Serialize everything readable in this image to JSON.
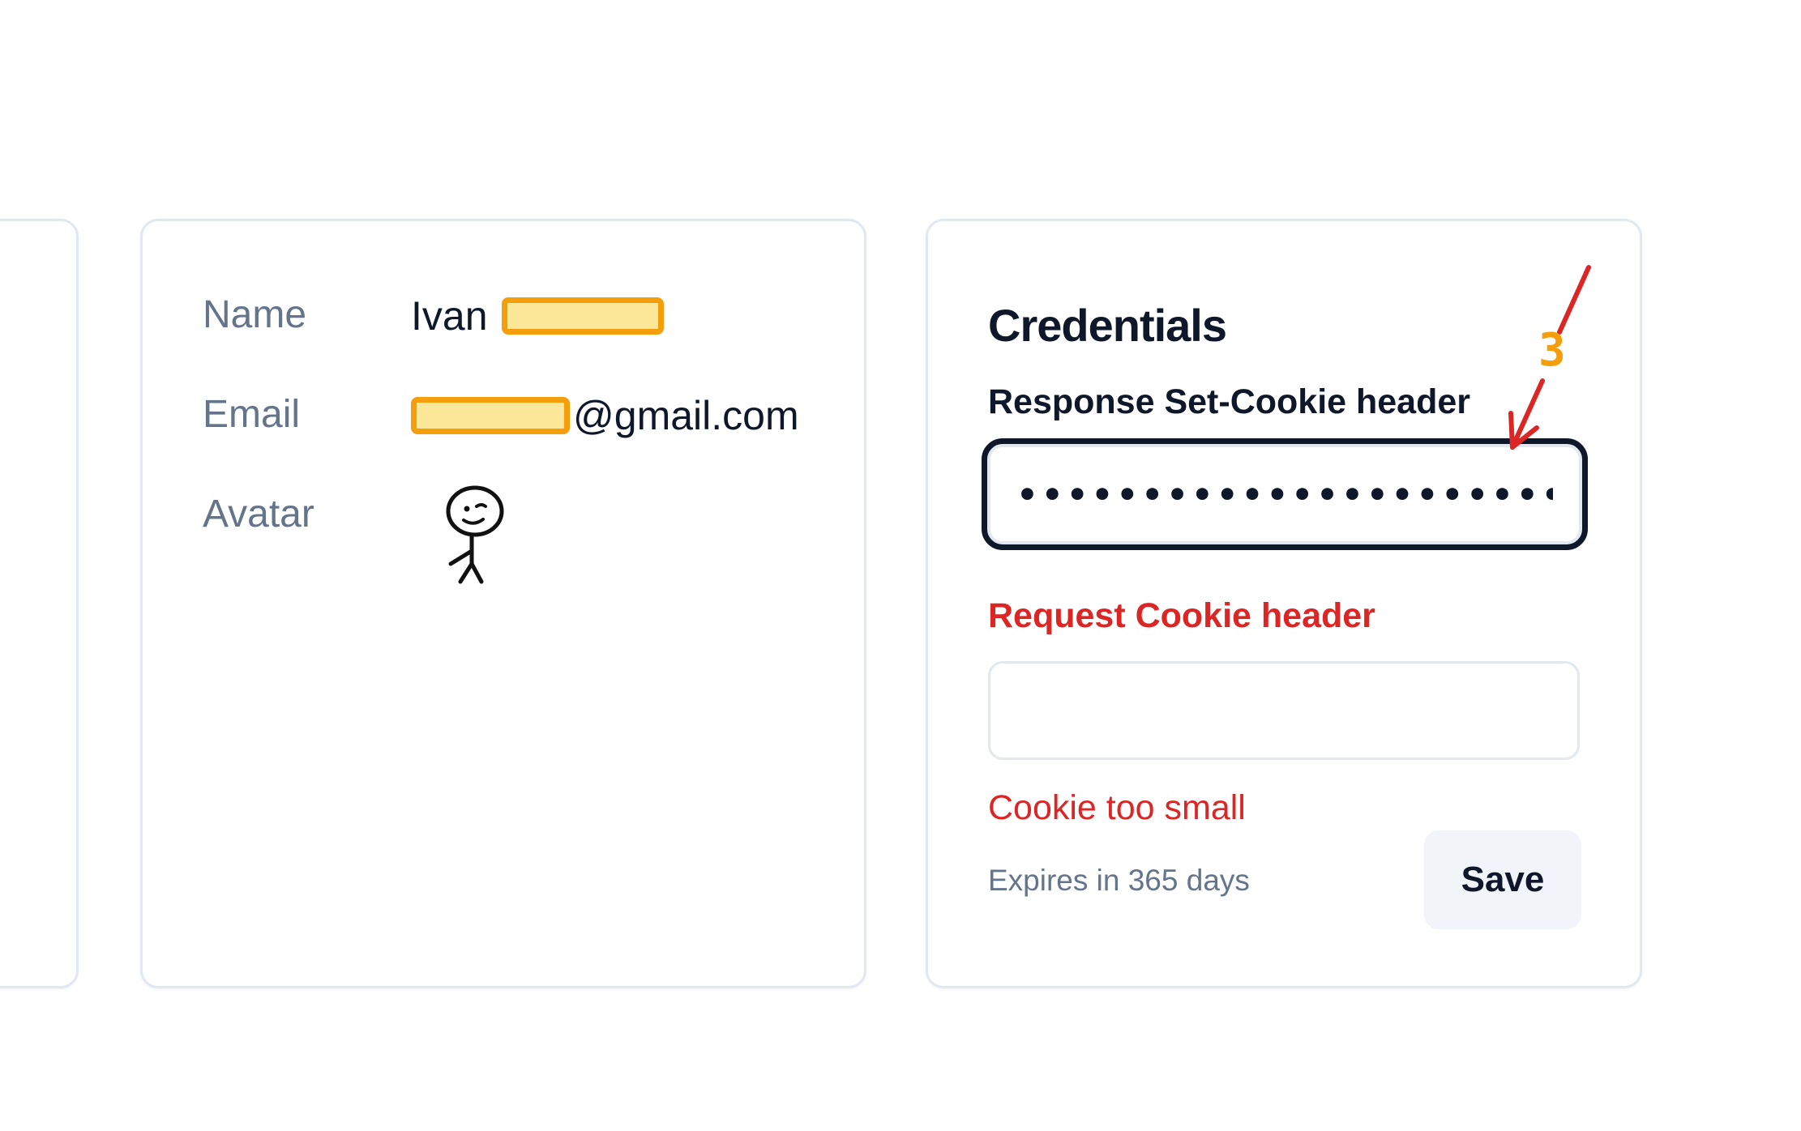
{
  "profile": {
    "name_label": "Name",
    "name_value": "Ivan",
    "email_label": "Email",
    "email_suffix": "@gmail.com",
    "avatar_label": "Avatar"
  },
  "credentials": {
    "title": "Credentials",
    "set_cookie_label": "Response Set-Cookie header",
    "set_cookie_value": "••••••••••••••••••••••••••••••",
    "cookie_label": "Request Cookie header",
    "cookie_value": "",
    "error_message": "Cookie too small",
    "expires_text": "Expires in 365 days",
    "save_label": "Save"
  },
  "annotation": {
    "number": "3"
  },
  "colors": {
    "error": "#dc2626",
    "text": "#0f172a",
    "muted": "#64748b",
    "border": "#e2e8f0",
    "redaction_fill": "#fde89a",
    "redaction_border": "#f59e0b",
    "annotation_arrow": "#dc2626",
    "annotation_number": "#f59e0b"
  }
}
